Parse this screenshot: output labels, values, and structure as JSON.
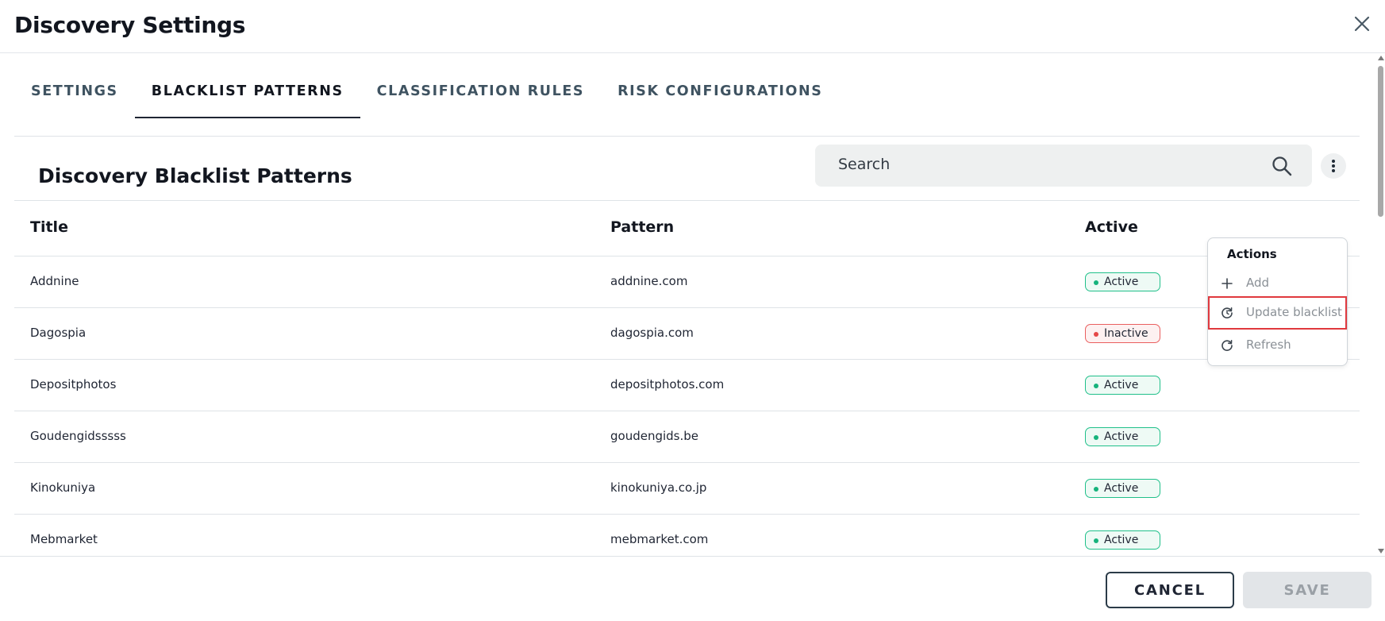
{
  "header": {
    "title": "Discovery Settings"
  },
  "tabs": [
    {
      "label": "SETTINGS",
      "active": false
    },
    {
      "label": "BLACKLIST PATTERNS",
      "active": true
    },
    {
      "label": "CLASSIFICATION RULES",
      "active": false
    },
    {
      "label": "RISK CONFIGURATIONS",
      "active": false
    }
  ],
  "section": {
    "title": "Discovery Blacklist Patterns"
  },
  "search": {
    "placeholder": "Search",
    "icon": "search-icon"
  },
  "table": {
    "columns": [
      "Title",
      "Pattern",
      "Active"
    ],
    "rows": [
      {
        "title": "Addnine",
        "pattern": "addnine.com",
        "status": "Active"
      },
      {
        "title": "Dagospia",
        "pattern": "dagospia.com",
        "status": "Inactive"
      },
      {
        "title": "Depositphotos",
        "pattern": "depositphotos.com",
        "status": "Active"
      },
      {
        "title": "Goudengidsssss",
        "pattern": "goudengids.be",
        "status": "Active"
      },
      {
        "title": "Kinokuniya",
        "pattern": "kinokuniya.co.jp",
        "status": "Active"
      },
      {
        "title": "Mebmarket",
        "pattern": "mebmarket.com",
        "status": "Active"
      }
    ]
  },
  "actions_menu": {
    "title": "Actions",
    "items": [
      {
        "label": "Add",
        "icon": "plus-icon"
      },
      {
        "label": "Update blacklist",
        "icon": "update-icon",
        "highlighted": true
      },
      {
        "label": "Refresh",
        "icon": "refresh-icon"
      }
    ]
  },
  "footer": {
    "cancel_label": "CANCEL",
    "save_label": "SAVE"
  },
  "colors": {
    "active_badge": "#20c08a",
    "inactive_badge": "#ea5f5f",
    "highlight_outline": "#e0393e"
  }
}
